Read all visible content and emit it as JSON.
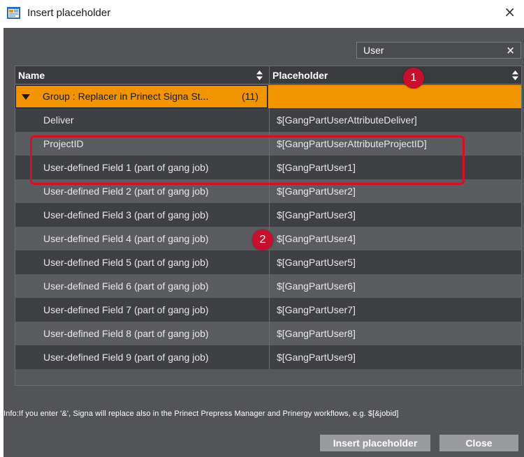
{
  "window": {
    "title": "Insert placeholder",
    "close_glyph": "×"
  },
  "search": {
    "value": "User",
    "clear_glyph": "×"
  },
  "table": {
    "headers": {
      "name": "Name",
      "placeholder": "Placeholder"
    },
    "group": {
      "label": "Group : Replacer in Prinect Signa St...",
      "count": "(11)"
    },
    "rows": [
      {
        "name": "Deliver",
        "placeholder": "$[GangPartUserAttributeDeliver]"
      },
      {
        "name": "ProjectID",
        "placeholder": "$[GangPartUserAttributeProjectID]"
      },
      {
        "name": "User-defined Field 1 (part of gang job)",
        "placeholder": "$[GangPartUser1]"
      },
      {
        "name": "User-defined Field 2 (part of gang job)",
        "placeholder": "$[GangPartUser2]"
      },
      {
        "name": "User-defined Field 3 (part of gang job)",
        "placeholder": "$[GangPartUser3]"
      },
      {
        "name": "User-defined Field 4 (part of gang job)",
        "placeholder": "$[GangPartUser4]"
      },
      {
        "name": "User-defined Field 5 (part of gang job)",
        "placeholder": "$[GangPartUser5]"
      },
      {
        "name": "User-defined Field 6 (part of gang job)",
        "placeholder": "$[GangPartUser6]"
      },
      {
        "name": "User-defined Field 7 (part of gang job)",
        "placeholder": "$[GangPartUser7]"
      },
      {
        "name": "User-defined Field 8 (part of gang job)",
        "placeholder": "$[GangPartUser8]"
      },
      {
        "name": "User-defined Field 9 (part of gang job)",
        "placeholder": "$[GangPartUser9]"
      }
    ]
  },
  "annotations": {
    "marker_1": "1",
    "marker_2": "2"
  },
  "info_text": "Info:If you enter '&', Signa will replace also in the Prinect Prepress Manager and Prinergy workflows, e.g. $[&jobid]",
  "buttons": {
    "insert": "Insert placeholder",
    "close": "Close"
  },
  "colors": {
    "group_highlight": "#f29400",
    "annotation_red": "#c8102e",
    "panel_bg": "#535458"
  },
  "icons": {
    "app": "insert-placeholder-app-icon",
    "sort": "sort-updown-icon",
    "expand": "triangle-down-icon"
  }
}
